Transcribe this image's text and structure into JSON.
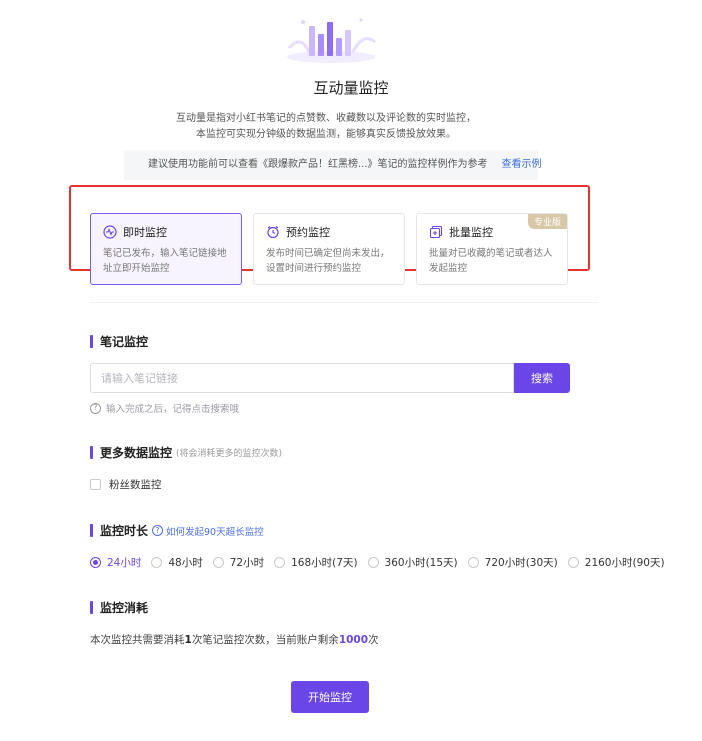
{
  "header": {
    "title": "互动量监控",
    "description_line1": "互动量是指对小红书笔记的点赞数、收藏数以及评论数的实时监控，",
    "description_line2": "本监控可实现分钟级的数据监测，能够真实反馈投放效果。"
  },
  "tip": {
    "text": "建议使用功能前可以查看《跟爆款产品！红黑榜...》笔记的监控样例作为参考",
    "link": "查看示例"
  },
  "modes": [
    {
      "title": "即时监控",
      "desc": "笔记已发布，输入笔记链接地址立即开始监控",
      "icon": "pulse-icon",
      "active": true
    },
    {
      "title": "预约监控",
      "desc": "发布时间已确定但尚未发出，设置时间进行预约监控",
      "icon": "alarm-clock-icon",
      "active": false
    },
    {
      "title": "批量监控",
      "desc": "批量对已收藏的笔记或者达人发起监控",
      "icon": "batch-icon",
      "active": false,
      "badge": "专业版"
    }
  ],
  "note_monitor": {
    "title": "笔记监控",
    "placeholder": "请输入笔记链接",
    "search_label": "搜索",
    "hint": "输入完成之后，记得点击搜索哦"
  },
  "more_data": {
    "title": "更多数据监控",
    "note": "(将会消耗更多的监控次数)",
    "checkbox_label": "粉丝数监控",
    "checked": false
  },
  "duration": {
    "title": "监控时长",
    "help_link": "如何发起90天超长监控",
    "options": [
      "24小时",
      "48小时",
      "72小时",
      "168小时(7天)",
      "360小时(15天)",
      "720小时(30天)",
      "2160小时(90天)"
    ],
    "selected": "24小时"
  },
  "cost": {
    "title": "监控消耗",
    "prefix": "本次监控共需要消耗",
    "count": "1",
    "mid": "次笔记监控次数，当前账户剩余",
    "remaining": "1000",
    "suffix": "次"
  },
  "actions": {
    "start_label": "开始监控"
  },
  "colors": {
    "accent": "#6a45e8",
    "highlight_frame": "#e3342f",
    "link": "#3b6fe0",
    "badge": "#d8c8a8"
  }
}
